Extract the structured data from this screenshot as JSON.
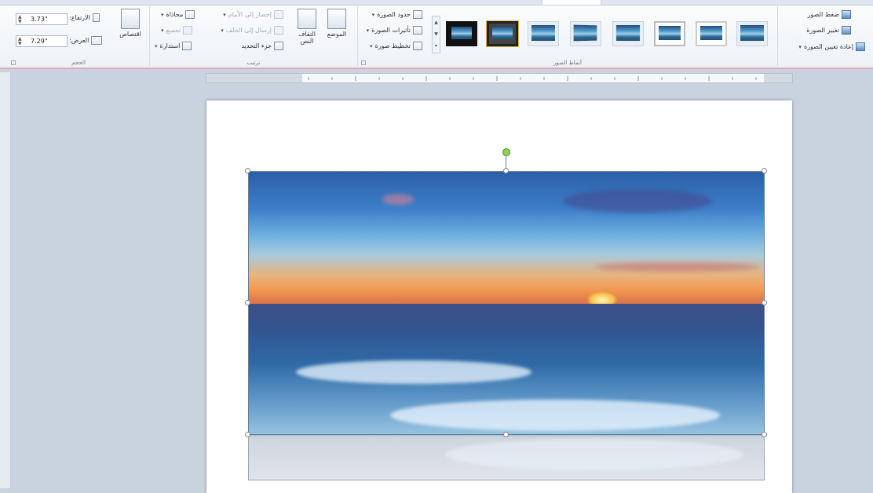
{
  "ribbon": {
    "adjust": {
      "compress": "ضغط الصور",
      "change": "تغيير الصورة",
      "reset": "إعادة تعيين الصورة"
    },
    "styles": {
      "label": "أنماط الصور",
      "thumbs": [
        "1",
        "2",
        "3",
        "4",
        "5",
        "6",
        "7",
        "8",
        "9",
        "10"
      ],
      "border": "حدود الصورة",
      "effects": "تأثيرات الصورة",
      "layout": "تخطيط صورة"
    },
    "arrange": {
      "label": "ترتيب",
      "position": "الموضع",
      "wrap": "التفاف النص",
      "bring_forward": "إحضار إلى الأمام",
      "send_backward": "إرسال إلى الخلف",
      "selection_pane": "جزء التحديد",
      "align": "محاذاة",
      "group": "تجميع",
      "rotate": "استدارة"
    },
    "size": {
      "label": "الحجم",
      "crop": "اقتصاص",
      "height_label": "الارتفاع:",
      "height_value": "3.73\"",
      "width_label": "العرض:",
      "width_value": "7.29\""
    }
  },
  "colors": {
    "accent_border": "#e7a8b5",
    "rotate_handle": "#8bd160"
  }
}
